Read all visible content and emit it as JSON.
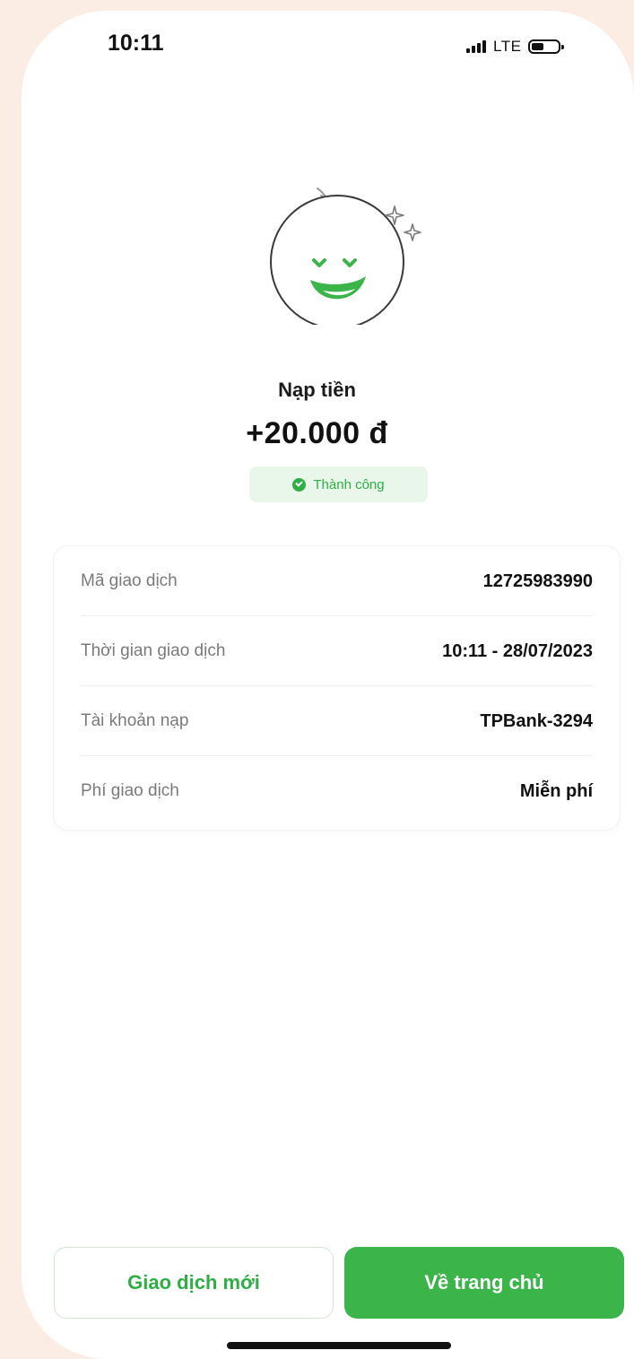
{
  "status_bar": {
    "time": "10:11",
    "network": "LTE",
    "icons": [
      "signal-icon",
      "battery-icon"
    ]
  },
  "mascot": {
    "icon": "happy-face-mascot-icon",
    "accent_color": "#3bb44a"
  },
  "transaction": {
    "title": "Nạp tiền",
    "amount": "+20.000 đ",
    "status": "Thành công"
  },
  "details": [
    {
      "label": "Mã giao dịch",
      "value": "12725983990"
    },
    {
      "label": "Thời gian giao dịch",
      "value": "10:11 - 28/07/2023"
    },
    {
      "label": "Tài khoản nạp",
      "value": "TPBank-3294"
    },
    {
      "label": "Phí giao dịch",
      "value": "Miễn phí"
    }
  ],
  "actions": {
    "new_transaction_label": "Giao dịch mới",
    "home_label": "Về trang chủ"
  },
  "colors": {
    "brand_green": "#3bb44a",
    "success_text": "#2fae45",
    "success_bg": "#e9f7eb",
    "page_background": "#fbece4"
  }
}
